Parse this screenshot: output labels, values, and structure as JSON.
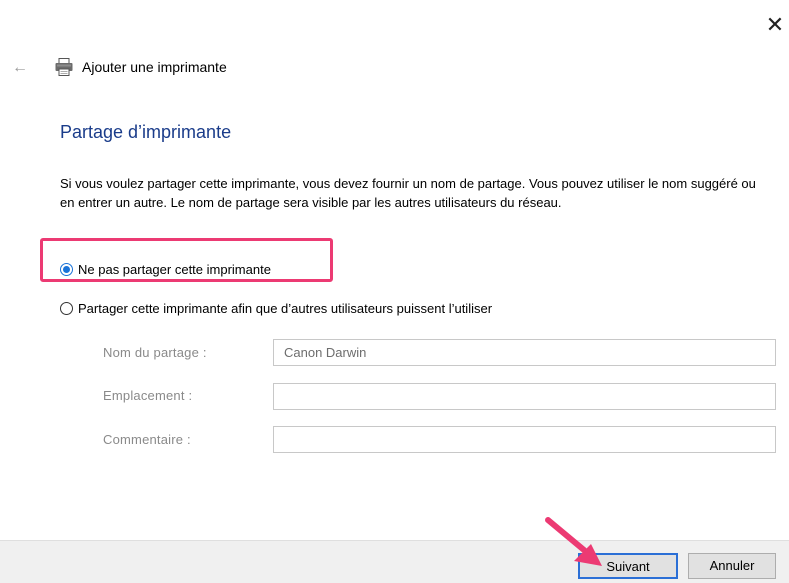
{
  "window": {
    "close_glyph": "✕",
    "back_glyph": "←",
    "title": "Ajouter une imprimante",
    "icons": [
      "close-icon",
      "back-arrow-icon",
      "printer-icon"
    ]
  },
  "page": {
    "heading": "Partage d’imprimante",
    "description": "Si vous voulez partager cette imprimante, vous devez fournir un nom de partage. Vous pouvez utiliser le nom suggéré ou en entrer un autre. Le nom de partage sera visible par les autres utilisateurs du réseau."
  },
  "options": {
    "no_share_label": "Ne pas partager cette imprimante",
    "no_share_selected": true,
    "share_label": "Partager cette imprimante afin que d’autres utilisateurs puissent l’utiliser",
    "share_selected": false
  },
  "fields": {
    "share_name_label": "Nom du partage :",
    "share_name_value": "Canon Darwin",
    "location_label": "Emplacement :",
    "location_value": "",
    "comment_label": "Commentaire :",
    "comment_value": ""
  },
  "buttons": {
    "next_label": "Suivant",
    "cancel_label": "Annuler"
  },
  "colors": {
    "heading": "#1a3c8a",
    "highlight": "#ec3a73",
    "arrow": "#ec3a73",
    "radio_selected": "#1a73d8",
    "default_button_border": "#2b6fd6",
    "footer_bg": "#f0f0f0"
  }
}
